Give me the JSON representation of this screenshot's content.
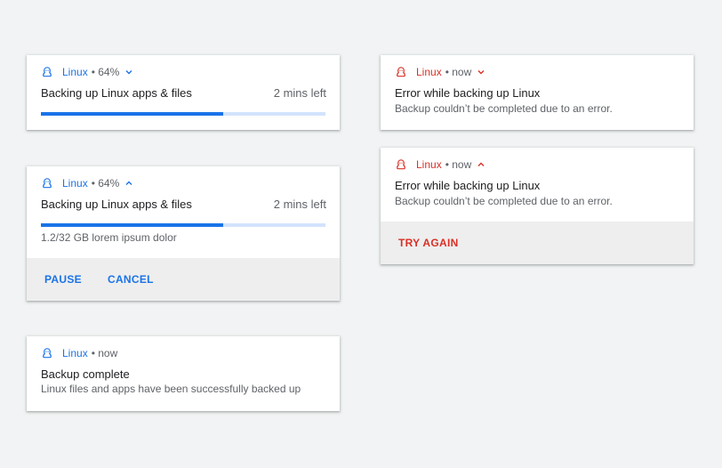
{
  "colors": {
    "accent": "#1a73e8",
    "error": "#d93025",
    "progress_track": "#d2e3fc",
    "action_bar": "#eeeeee",
    "background": "#f1f3f4"
  },
  "progress_collapsed": {
    "icon": "linux-penguin-icon",
    "app_name": "Linux",
    "meta": "• 64%",
    "chevron": "chevron-down-icon",
    "title": "Backing up Linux apps & files",
    "time_left": "2 mins left",
    "progress": 0.64
  },
  "progress_expanded": {
    "icon": "linux-penguin-icon",
    "app_name": "Linux",
    "meta": "• 64%",
    "chevron": "chevron-up-icon",
    "title": "Backing up Linux apps & files",
    "time_left": "2 mins left",
    "progress": 0.64,
    "detail": "1.2/32 GB lorem ipsum dolor",
    "actions": {
      "pause": "PAUSE",
      "cancel": "CANCEL"
    }
  },
  "complete": {
    "icon": "linux-penguin-icon",
    "app_name": "Linux",
    "meta": "• now",
    "title": "Backup complete",
    "message": "Linux files and apps have been successfully backed up"
  },
  "error_collapsed": {
    "icon": "linux-penguin-icon",
    "app_name": "Linux",
    "meta": "• now",
    "chevron": "chevron-down-icon",
    "title": "Error while backing up Linux",
    "message": "Backup couldn’t be completed due to an error."
  },
  "error_expanded": {
    "icon": "linux-penguin-icon",
    "app_name": "Linux",
    "meta": "• now",
    "chevron": "chevron-up-icon",
    "title": "Error while backing up Linux",
    "message": "Backup couldn’t be completed due to an error.",
    "actions": {
      "try_again": "TRY AGAIN"
    }
  }
}
